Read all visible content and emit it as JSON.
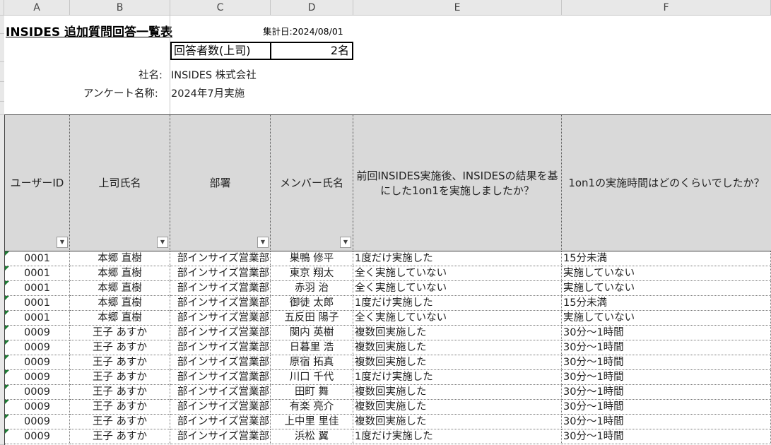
{
  "columns": [
    "A",
    "B",
    "C",
    "D",
    "E",
    "F"
  ],
  "title": "INSIDES  追加質問回答一覧表",
  "report_date": "集計日:2024/08/01",
  "respondents": {
    "label": "回答者数(上司)",
    "value": "2名"
  },
  "company": {
    "label": "社名:",
    "value": "INSIDES 株式会社"
  },
  "survey": {
    "label": "アンケート名称:",
    "value": "2024年7月実施"
  },
  "headers": [
    "ユーザーID",
    "上司氏名",
    "部署",
    "メンバー氏名",
    "前回INSIDES実施後、INSIDESの結果を基にした1on1を実施しましたか？",
    "1on1の実施時間はどのくらいでしたか？"
  ],
  "filter_icon": "dropdown-arrow-icon",
  "rows": [
    [
      "0001",
      "本郷 直樹",
      "部インサイズ営業部",
      "巣鴨 修平",
      "1度だけ実施した",
      "15分未満"
    ],
    [
      "0001",
      "本郷 直樹",
      "部インサイズ営業部",
      "東京 翔太",
      "全く実施していない",
      "実施していない"
    ],
    [
      "0001",
      "本郷 直樹",
      "部インサイズ営業部",
      "赤羽 治",
      "全く実施していない",
      "実施していない"
    ],
    [
      "0001",
      "本郷 直樹",
      "部インサイズ営業部",
      "御徒 太郎",
      "1度だけ実施した",
      "15分未満"
    ],
    [
      "0001",
      "本郷 直樹",
      "部インサイズ営業部",
      "五反田 陽子",
      "全く実施していない",
      "実施していない"
    ],
    [
      "0009",
      "王子 あすか",
      "部インサイズ営業部",
      "関内 英樹",
      "複数回実施した",
      "30分〜1時間"
    ],
    [
      "0009",
      "王子 あすか",
      "部インサイズ営業部",
      "日暮里 浩",
      "複数回実施した",
      "30分〜1時間"
    ],
    [
      "0009",
      "王子 あすか",
      "部インサイズ営業部",
      "原宿 拓真",
      "複数回実施した",
      "30分〜1時間"
    ],
    [
      "0009",
      "王子 あすか",
      "部インサイズ営業部",
      "川口 千代",
      "1度だけ実施した",
      "30分〜1時間"
    ],
    [
      "0009",
      "王子 あすか",
      "部インサイズ営業部",
      "田町 舞",
      "複数回実施した",
      "30分〜1時間"
    ],
    [
      "0009",
      "王子 あすか",
      "部インサイズ営業部",
      "有楽 亮介",
      "複数回実施した",
      "30分〜1時間"
    ],
    [
      "0009",
      "王子 あすか",
      "部インサイズ営業部",
      "上中里 里佳",
      "複数回実施した",
      "30分〜1時間"
    ],
    [
      "0009",
      "王子 あすか",
      "部インサイズ営業部",
      "浜松 翼",
      "1度だけ実施した",
      "30分〜1時間"
    ]
  ]
}
